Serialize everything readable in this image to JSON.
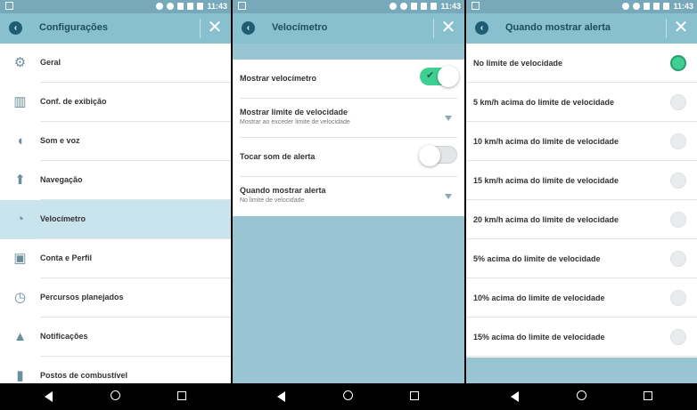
{
  "status_bar": {
    "time": "11:43"
  },
  "panel1": {
    "title": "Configurações",
    "items": [
      {
        "label": "Geral",
        "icon": "gear-icon"
      },
      {
        "label": "Conf. de exibição",
        "icon": "map-icon"
      },
      {
        "label": "Som e voz",
        "icon": "speaker-icon"
      },
      {
        "label": "Navegação",
        "icon": "navigation-icon"
      },
      {
        "label": "Velocímetro",
        "icon": "speedometer-icon"
      },
      {
        "label": "Conta e Perfil",
        "icon": "profile-icon"
      },
      {
        "label": "Percursos planejados",
        "icon": "alarm-clock-icon"
      },
      {
        "label": "Notificações",
        "icon": "bell-icon"
      },
      {
        "label": "Postos de combustível",
        "icon": "fuel-icon"
      }
    ],
    "active_index": 4
  },
  "panel2": {
    "title": "Velocímetro",
    "rows": {
      "show_speedometer": {
        "label": "Mostrar velocímetro",
        "toggle_on": true
      },
      "show_speed_limit": {
        "label": "Mostrar limite de velocidade",
        "value": "Mostrar ao exceder limite de velocidade"
      },
      "alert_sound": {
        "label": "Tocar som de alerta",
        "toggle_on": false
      },
      "when_alert": {
        "label": "Quando mostrar alerta",
        "value": "No limite de velocidade"
      }
    }
  },
  "panel3": {
    "title": "Quando mostrar alerta",
    "options": [
      "No limite de velocidade",
      "5 km/h acima do limite de velocidade",
      "10 km/h acima do limite de velocidade",
      "15 km/h acima do limite de velocidade",
      "20 km/h acima do limite de velocidade",
      "5% acima do limite de velocidade",
      "10% acima do limite de velocidade",
      "15% acima do limite de velocidade"
    ],
    "selected_index": 0
  },
  "colors": {
    "appbar": "#89c0d0",
    "accent": "#3fcf92",
    "active_item": "#c9e4ec"
  }
}
